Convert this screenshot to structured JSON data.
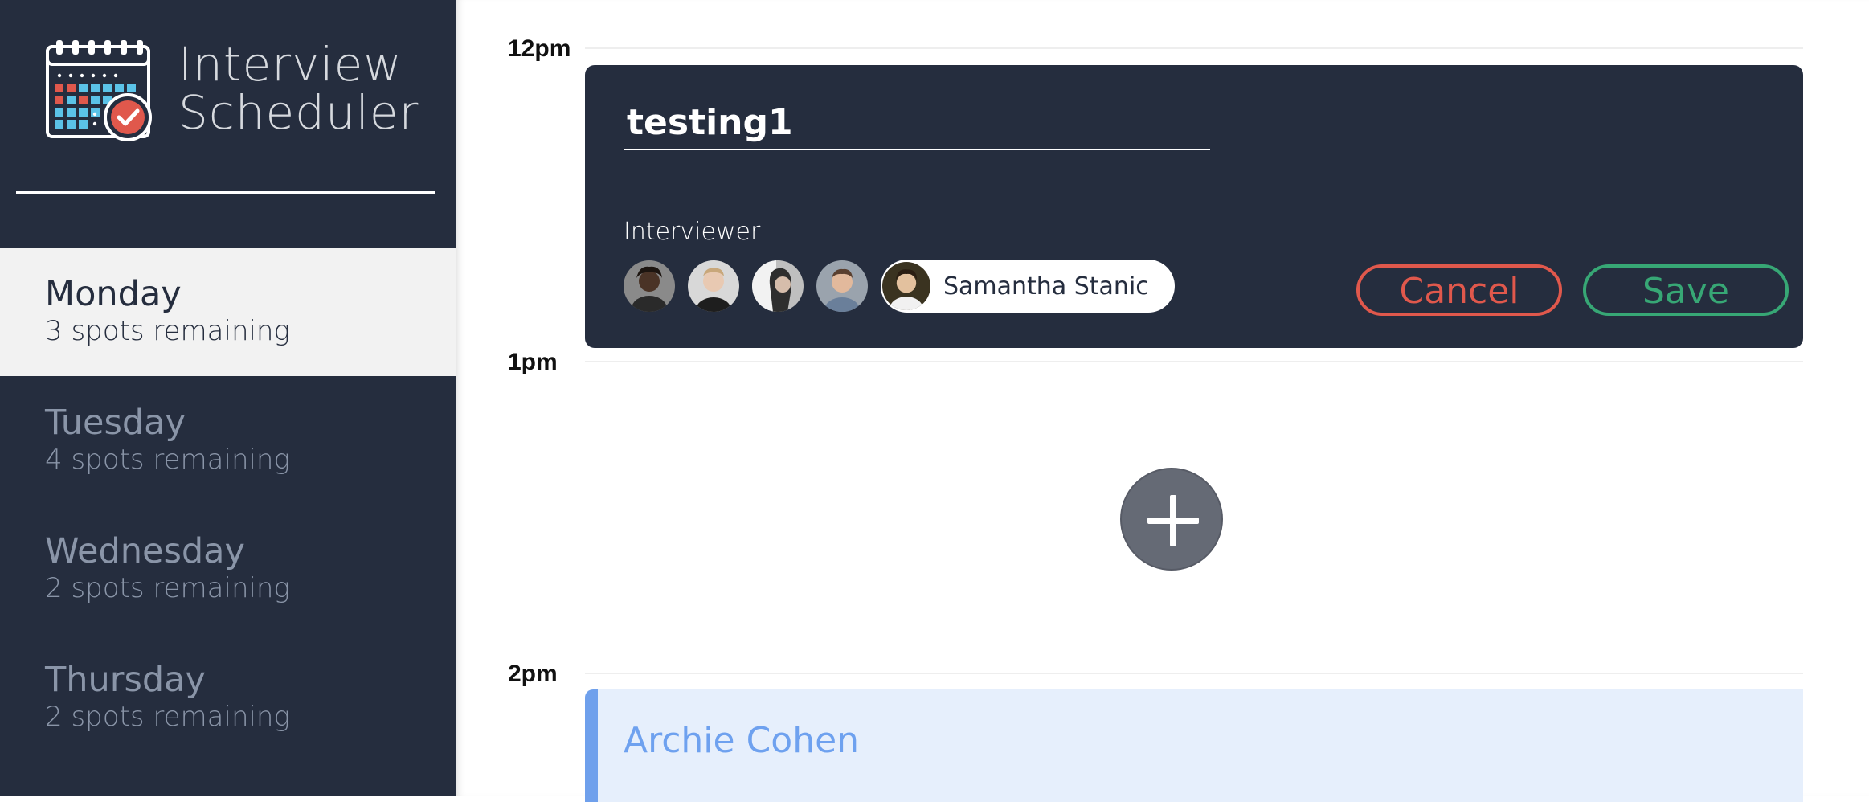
{
  "app": {
    "title_line1": "Interview",
    "title_line2": "Scheduler",
    "logo_icon": "calendar-check-icon"
  },
  "days": [
    {
      "name": "Monday",
      "spots": "3 spots remaining",
      "selected": true
    },
    {
      "name": "Tuesday",
      "spots": "4 spots remaining",
      "selected": false
    },
    {
      "name": "Wednesday",
      "spots": "2 spots remaining",
      "selected": false
    },
    {
      "name": "Thursday",
      "spots": "2 spots remaining",
      "selected": false
    }
  ],
  "schedule": {
    "times": [
      "12pm",
      "1pm",
      "2pm"
    ]
  },
  "form": {
    "student_value": "testing1",
    "interviewer_heading": "Interviewer",
    "selected_interviewer": "Samantha Stanic",
    "cancel_label": "Cancel",
    "save_label": "Save"
  },
  "appointment": {
    "student": "Archie Cohen"
  },
  "add_button_icon": "plus-icon",
  "colors": {
    "sidebar_bg": "#252d3e",
    "selected_day_bg": "#f2f2f2",
    "cancel": "#e0584c",
    "save": "#37a775",
    "appointment_accent": "#6fa0ec",
    "appointment_bg": "#e6effc"
  }
}
